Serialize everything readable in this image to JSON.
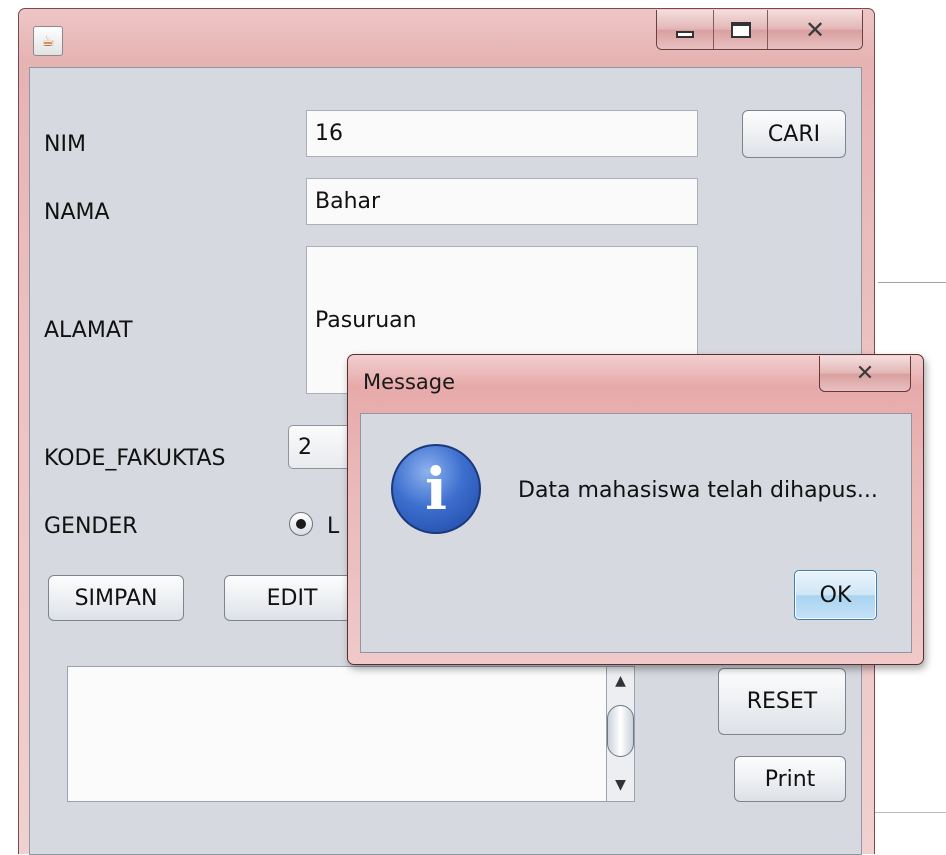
{
  "window": {
    "app_icon": "java-coffee-icon",
    "controls": {
      "minimize": "minimize-icon",
      "maximize": "maximize-icon",
      "close": "✕"
    }
  },
  "form": {
    "nim": {
      "label": "NIM",
      "value": "16"
    },
    "nama": {
      "label": "NAMA",
      "value": "Bahar"
    },
    "alamat": {
      "label": "ALAMAT",
      "value": "Pasuruan"
    },
    "kode_fakultas": {
      "label": "KODE_FAKUKTAS",
      "value": "2"
    },
    "gender": {
      "label": "GENDER",
      "option_label": "L",
      "selected": true
    }
  },
  "buttons": {
    "cari": "CARI",
    "simpan": "SIMPAN",
    "edit": "EDIT",
    "reset": "RESET",
    "print": "Print"
  },
  "scrollbar": {
    "up": "▲",
    "down": "▼"
  },
  "dialog": {
    "title": "Message",
    "close": "✕",
    "icon": "information-icon",
    "icon_glyph": "i",
    "message": "Data mahasiswa telah dihapus...",
    "ok_label": "OK"
  }
}
